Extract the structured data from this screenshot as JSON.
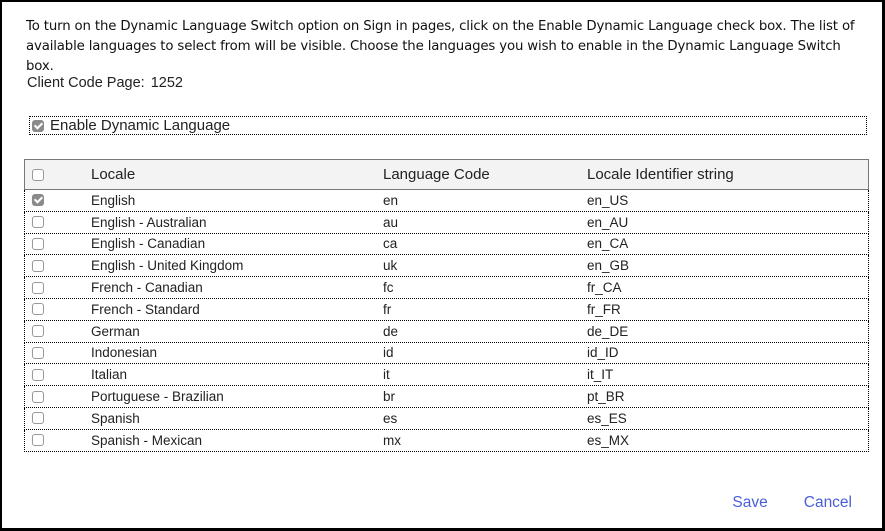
{
  "intro_text": "To turn on the Dynamic Language Switch option on Sign in pages, click on the Enable Dynamic Language check box. The list of available languages to select from will be visible. Choose the languages you wish to enable in the Dynamic Language Switch box.",
  "client_code_page": {
    "label": "Client Code Page:",
    "value": "1252"
  },
  "enable_dynamic_language": {
    "label": "Enable Dynamic Language",
    "checked": true
  },
  "table": {
    "select_all_checked": false,
    "columns": [
      "Locale",
      "Language Code",
      "Locale Identifier string"
    ],
    "rows": [
      {
        "locale": "English",
        "code": "en",
        "identifier": "en_US",
        "checked": true
      },
      {
        "locale": "English - Australian",
        "code": "au",
        "identifier": "en_AU",
        "checked": false
      },
      {
        "locale": "English - Canadian",
        "code": "ca",
        "identifier": "en_CA",
        "checked": false
      },
      {
        "locale": "English - United Kingdom",
        "code": "uk",
        "identifier": "en_GB",
        "checked": false
      },
      {
        "locale": "French - Canadian",
        "code": "fc",
        "identifier": "fr_CA",
        "checked": false
      },
      {
        "locale": "French - Standard",
        "code": "fr",
        "identifier": "fr_FR",
        "checked": false
      },
      {
        "locale": "German",
        "code": "de",
        "identifier": "de_DE",
        "checked": false
      },
      {
        "locale": "Indonesian",
        "code": "id",
        "identifier": "id_ID",
        "checked": false
      },
      {
        "locale": "Italian",
        "code": "it",
        "identifier": "it_IT",
        "checked": false
      },
      {
        "locale": "Portuguese - Brazilian",
        "code": "br",
        "identifier": "pt_BR",
        "checked": false
      },
      {
        "locale": "Spanish",
        "code": "es",
        "identifier": "es_ES",
        "checked": false
      },
      {
        "locale": "Spanish - Mexican",
        "code": "mx",
        "identifier": "es_MX",
        "checked": false
      }
    ]
  },
  "buttons": {
    "save": "Save",
    "cancel": "Cancel"
  },
  "colors": {
    "link_button": "#4a5fd6",
    "header_bg": "#f3f3f3",
    "checked_box": "#8a8a8a"
  }
}
